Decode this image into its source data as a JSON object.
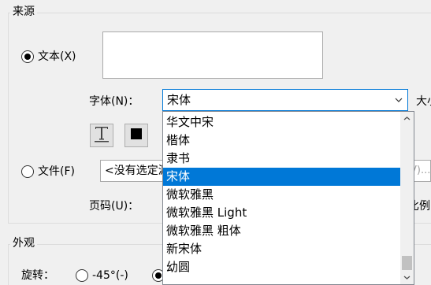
{
  "source_group": {
    "title": "来源",
    "text_radio_label": "文本(X)",
    "font_label": "字体(N)：",
    "font_value": "宋体",
    "size_label_partial": "大小",
    "file_radio_label": "文件(F)",
    "file_path": "<没有选定源文件>",
    "browse_partial": "V)...",
    "page_label": "页码(U)：",
    "scale_partial": "比例"
  },
  "font_dropdown": {
    "items": [
      "华文中宋",
      "楷体",
      "隶书",
      "宋体",
      "微软雅黑",
      "微软雅黑 Light",
      "微软雅黑 粗体",
      "新宋体",
      "幼圆"
    ],
    "selected": "宋体"
  },
  "appearance_group": {
    "title": "外观",
    "rotate_label": "旋转：",
    "rotate_option_1": "-45°(-)"
  },
  "icons": {
    "text_format": "text-format-icon",
    "color": "color-swatch-icon",
    "dropdown_arrow": "chevron-down-icon"
  },
  "colors": {
    "selection": "#0078d7",
    "background": "#f0f0f0"
  }
}
